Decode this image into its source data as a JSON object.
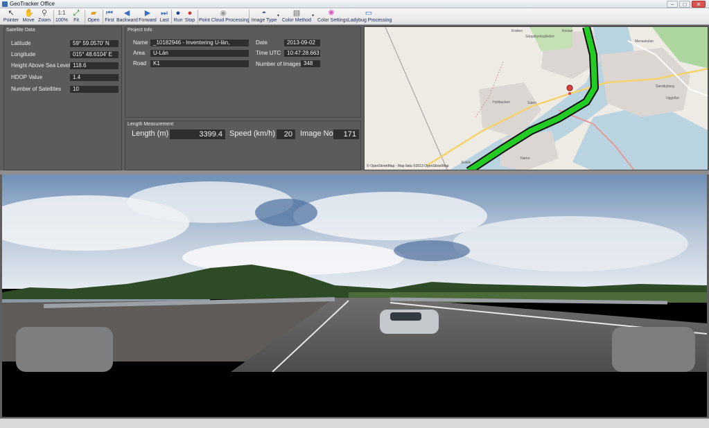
{
  "window": {
    "title": "GeoTracker Office",
    "minimize": "–",
    "maximize": "□",
    "close": "✕"
  },
  "toolbar": {
    "pointer": "Pointer",
    "move": "Move",
    "zoom": "Zoom",
    "zoom100": "100%",
    "fit": "Fit",
    "open": "Open",
    "first": "First",
    "backward": "Backward",
    "forward": "Forward",
    "last": "Last",
    "run": "Run",
    "stop": "Stop",
    "point_cloud": "Point Cloud Processing",
    "image_type": "Image Type",
    "color_method": "Color Method",
    "color_settings": "Color Settings",
    "ladybug": "Ladybug Processing"
  },
  "satellite": {
    "title": "Satellite Data",
    "latitude_label": "Latitude",
    "latitude": "59° 59.0570' N",
    "longitude_label": "Longitude",
    "longitude": "015° 48.6104' E",
    "height_label": "Height Above Sea Level",
    "height": "118.6",
    "hdop_label": "HDOP Value",
    "hdop": "1.4",
    "sats_label": "Number of Satellites",
    "sats": "10"
  },
  "project": {
    "title": "Project Info",
    "name_label": "Name",
    "name": "_10182946 - Inventering U-län,",
    "area_label": "Area",
    "area": "U-Län",
    "road_label": "Road",
    "road": "K1",
    "date_label": "Date",
    "date": "2013-09-02",
    "time_label": "Time UTC",
    "time": "10:47:28.663",
    "images_label": "Number of Images",
    "images": "348"
  },
  "length": {
    "title": "Length Measurement",
    "length_label": "Length (m)",
    "length": "3399.4",
    "speed_label": "Speed (km/h)",
    "speed": "20",
    "image_label": "Image No",
    "image_no": "171"
  },
  "map": {
    "labels": {
      "kratten": "Kratten",
      "seppsjo": "Seppskyrkogården",
      "kristan": "Kristan",
      "menaskolan": "Menaskolan",
      "hyttbacken": "Hyttbacken",
      "salenh": "Salen",
      "uggelbo": "Uggelbo",
      "eskiln": "Eskiln",
      "narbo": "Närbo",
      "sandbyberg": "Sandbyberg"
    },
    "attribution": "© OpenStreetMap - Map data ©2013 OpenStreetMap",
    "track_color": "#22cc22"
  }
}
